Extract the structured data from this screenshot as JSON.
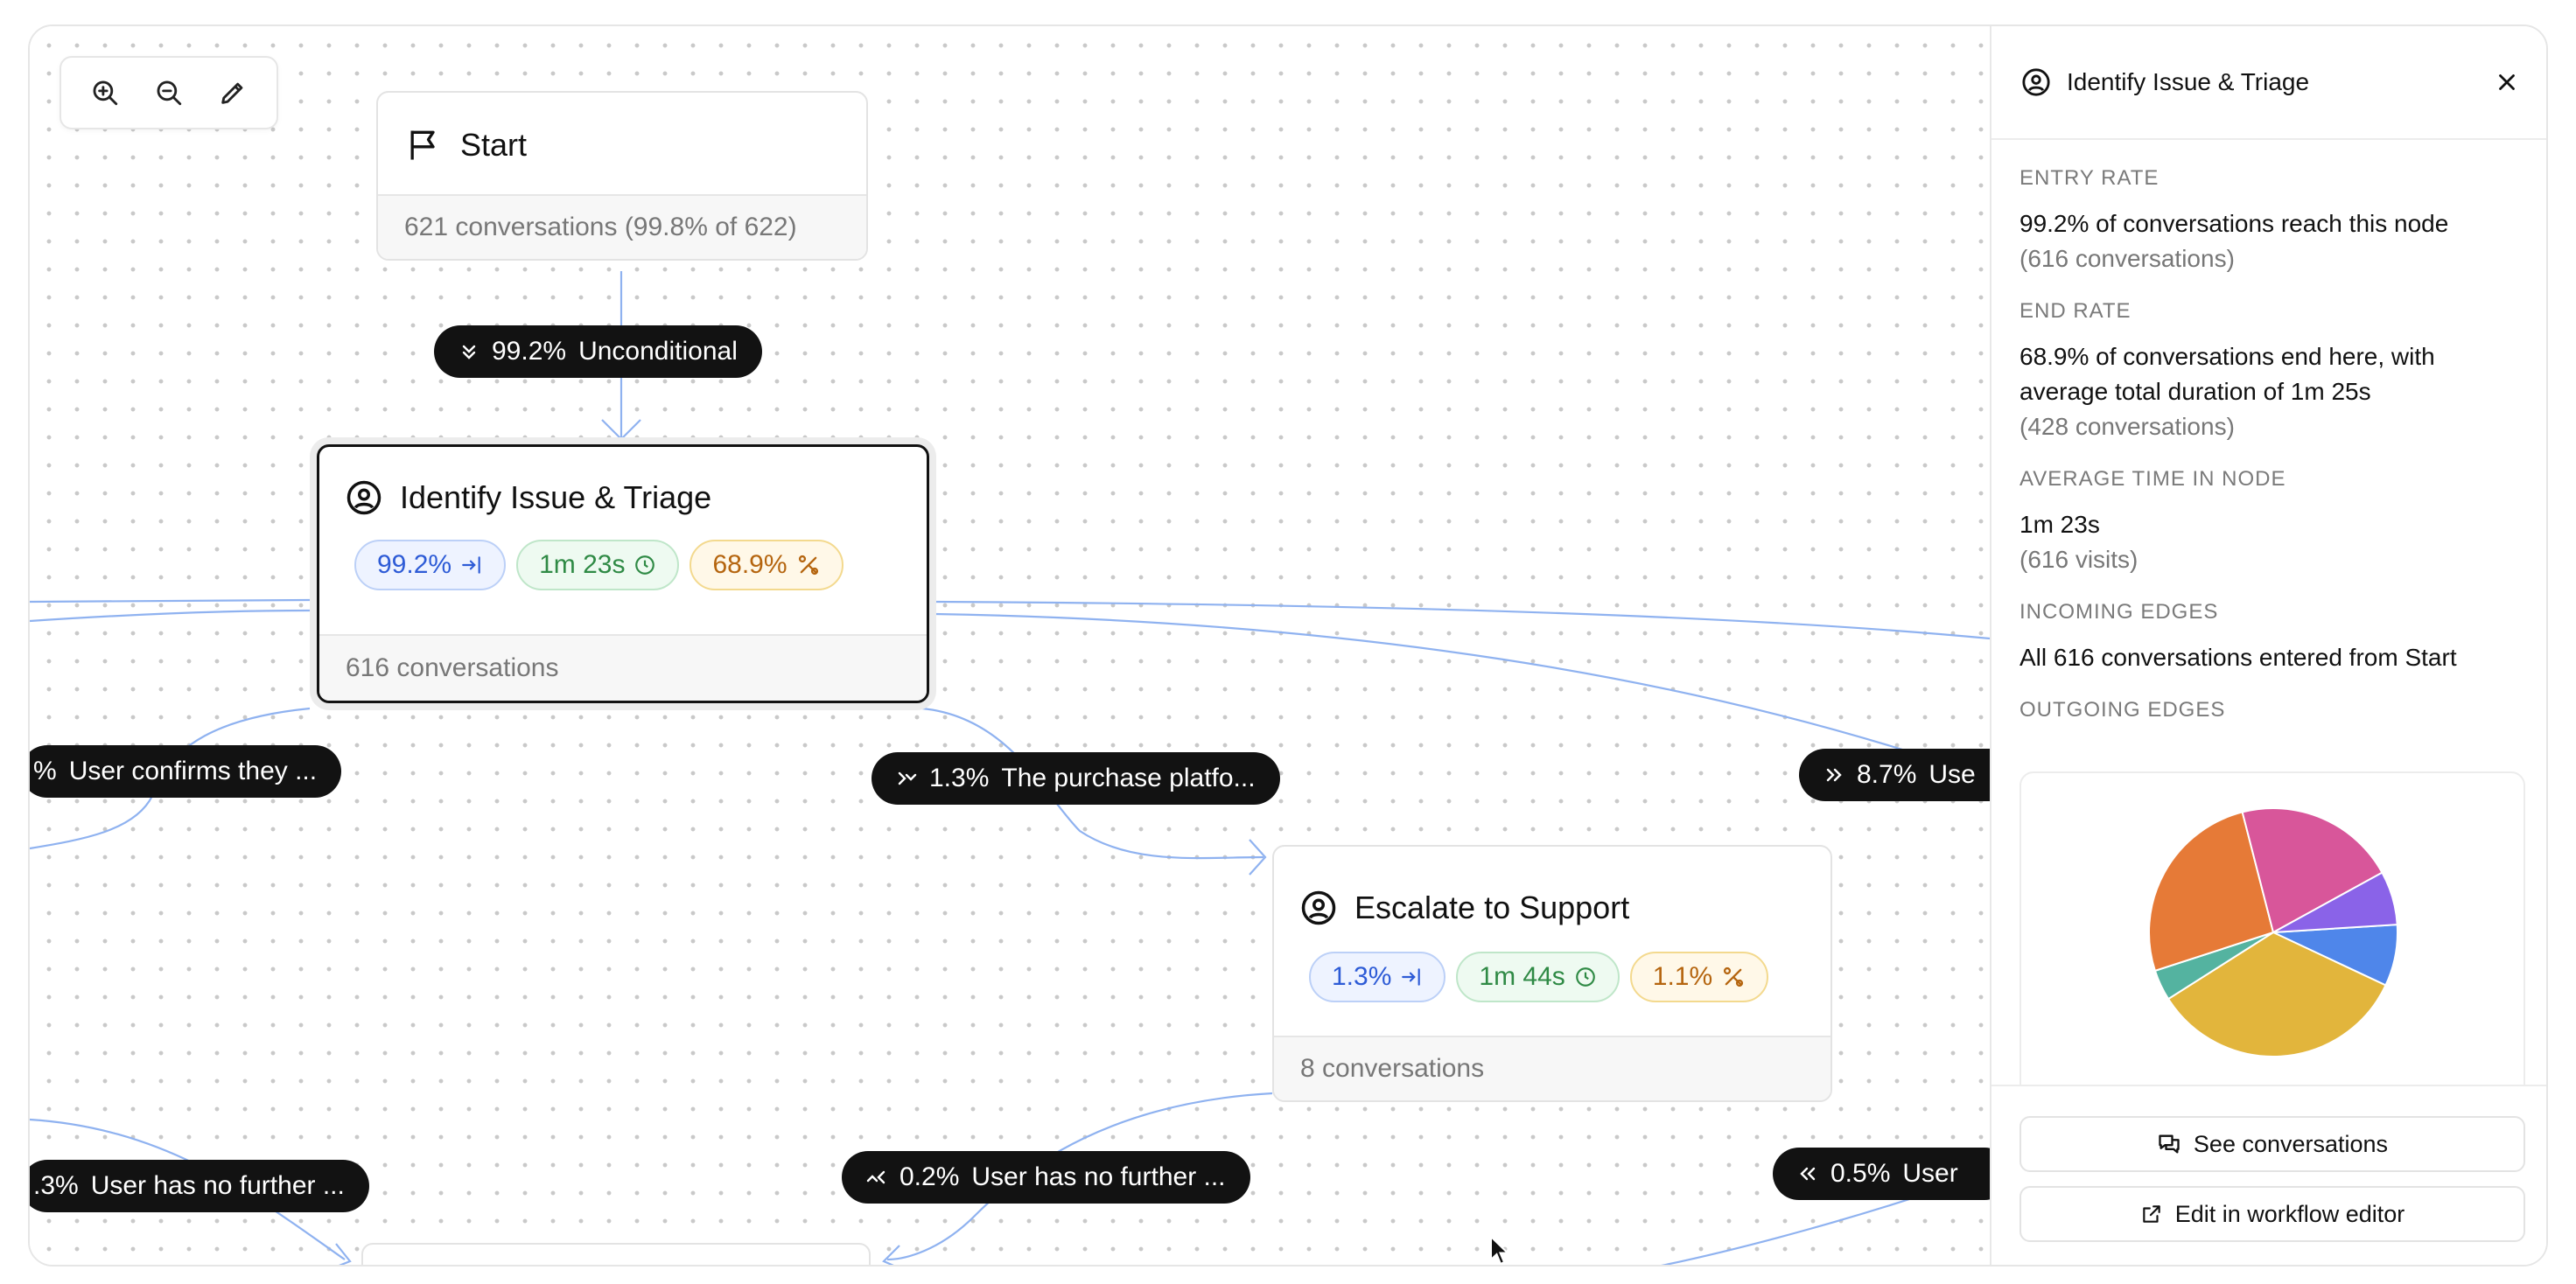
{
  "toolbar": {
    "zoom_in_icon": "zoom-in-icon",
    "zoom_out_icon": "zoom-out-icon",
    "edit_icon": "pencil-icon"
  },
  "nodes": {
    "start": {
      "title": "Start",
      "footer": "621 conversations (99.8% of 622)",
      "icon": "flag-icon"
    },
    "identify": {
      "title": "Identify Issue & Triage",
      "entry": "99.2%",
      "time": "1m 23s",
      "end": "68.9%",
      "footer": "616 conversations",
      "icon": "agent-face-icon"
    },
    "escalate": {
      "title": "Escalate to Support",
      "entry": "1.3%",
      "time": "1m 44s",
      "end": "1.1%",
      "footer": "8 conversations",
      "icon": "agent-face-icon"
    }
  },
  "edges": {
    "unconditional": {
      "pct": "99.2%",
      "label": "Unconditional"
    },
    "user_confirms": {
      "pct": "%",
      "label": "User confirms they ..."
    },
    "purchase": {
      "pct": "1.3%",
      "label": "The purchase platfo..."
    },
    "user_right": {
      "pct": "8.7%",
      "label": "Use"
    },
    "no_further_left": {
      "pct": ".3%",
      "label": "User has no further ..."
    },
    "no_further_mid": {
      "pct": "0.2%",
      "label": "User has no further ..."
    },
    "user_bottom_right": {
      "pct": "0.5%",
      "label": "User"
    }
  },
  "panel": {
    "title": "Identify Issue & Triage",
    "entry_label": "ENTRY RATE",
    "entry_text": "99.2% of conversations reach this node",
    "entry_sub": "(616 conversations)",
    "end_label": "END RATE",
    "end_text": "68.9% of conversations end here, with average total duration of 1m 25s",
    "end_sub": "(428 conversations)",
    "avg_label": "AVERAGE TIME IN NODE",
    "avg_text": "1m 23s",
    "avg_sub": "(616 visits)",
    "incoming_label": "INCOMING EDGES",
    "incoming_prefix": "All 616 conversations entered from",
    "incoming_source": "Start",
    "outgoing_label": "OUTGOING EDGES",
    "see_conversations": "See conversations",
    "edit_workflow": "Edit in workflow editor"
  },
  "colors": {
    "edge_line": "#8fb2f0",
    "pill_bg": "#121212",
    "accent_blue": "#2d5bd6",
    "accent_green": "#2f8a45",
    "accent_orange": "#b5650f"
  },
  "chart_data": {
    "type": "pie",
    "title": "",
    "slices": [
      {
        "color": "#4f86ea",
        "value": 8
      },
      {
        "color": "#e2b53c",
        "value": 34
      },
      {
        "color": "#54b3a0",
        "value": 4
      },
      {
        "color": "#e67a37",
        "value": 26
      },
      {
        "color": "#d8569a",
        "value": 21
      },
      {
        "color": "#8a63e8",
        "value": 7
      }
    ]
  }
}
